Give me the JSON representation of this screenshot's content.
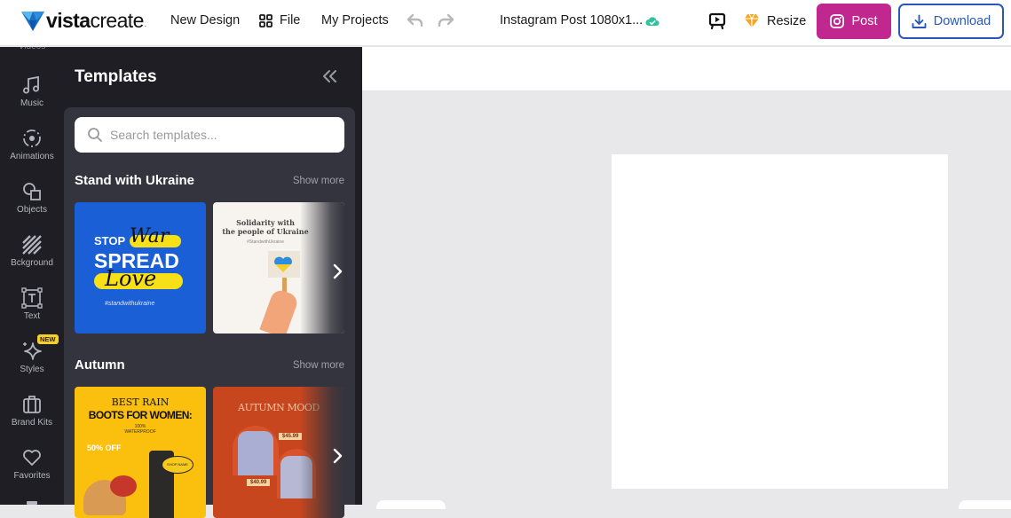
{
  "app": {
    "brand_bold": "vista",
    "brand_light": "create",
    "brand_dot": "."
  },
  "topbar": {
    "nav": [
      {
        "label": "New Design"
      },
      {
        "label": "File",
        "icon": "grid-icon"
      },
      {
        "label": "My Projects"
      }
    ],
    "undo_icon": "undo-icon",
    "redo_icon": "redo-icon",
    "document_title": "Instagram Post 1080x1...",
    "saved_status_icon": "cloud-check-icon",
    "present_icon": "present-icon",
    "resize_label": "Resize",
    "resize_icon": "diamond-icon",
    "post_label": "Post",
    "post_icon": "instagram-icon",
    "download_label": "Download",
    "download_icon": "download-icon"
  },
  "colors": {
    "post": "#c0288f",
    "download": "#2b58b8",
    "rail_bg": "#1e1e24",
    "panel_inner_bg": "#34343e",
    "new_badge": "#f7cf2a",
    "resize_icon": "#f5a623",
    "saved_icon": "#2ec39a"
  },
  "rail": {
    "cut_label": "Videos",
    "items": [
      {
        "label": "Music",
        "icon": "music-note-icon"
      },
      {
        "label": "Animations",
        "icon": "animation-icon"
      },
      {
        "label": "Objects",
        "icon": "shapes-icon"
      },
      {
        "label": "Bckground",
        "icon": "background-stripes-icon"
      },
      {
        "label": "Text",
        "icon": "text-box-icon"
      },
      {
        "label": "Styles",
        "icon": "sparkle-icon",
        "badge": "NEW"
      },
      {
        "label": "Brand Kits",
        "icon": "briefcase-icon"
      },
      {
        "label": "Favorites",
        "icon": "heart-icon"
      }
    ]
  },
  "panel": {
    "title": "Templates",
    "collapse_icon": "double-chevron-left-icon",
    "search_placeholder": "Search templates...",
    "sections": [
      {
        "title": "Stand with Ukraine",
        "show_more": "Show more",
        "templates": [
          {
            "lines": [
              "STOP",
              "War",
              "SPREAD",
              "Love",
              "#standwithukraine"
            ]
          },
          {
            "lines": [
              "Solidarity with",
              "the people of Ukraine",
              "#StandwithUkraine"
            ]
          }
        ]
      },
      {
        "title": "Autumn",
        "show_more": "Show more",
        "templates": [
          {
            "lines": [
              "BEST RAIN",
              "BOOTS FOR WOMEN:",
              "100%",
              "WATERPROOF",
              "50% OFF",
              "SHOP NAME"
            ]
          },
          {
            "lines": [
              "AUTUMN MOOD",
              "$45.99",
              "$40.99"
            ]
          }
        ]
      }
    ]
  }
}
